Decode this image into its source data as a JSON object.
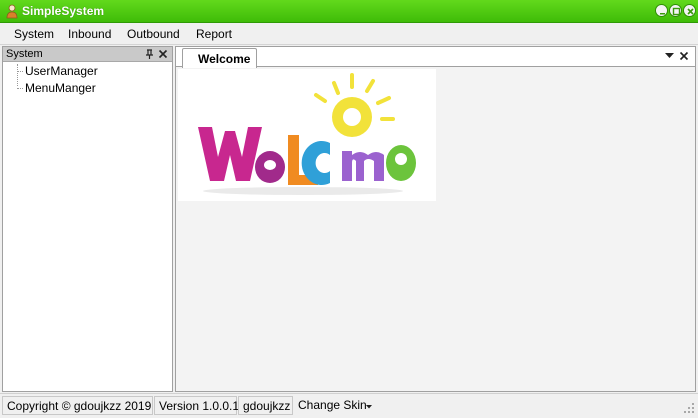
{
  "window": {
    "title": "SimpleSystem"
  },
  "menu": {
    "items": [
      "System",
      "Inbound",
      "Outbound",
      "Report"
    ]
  },
  "sidebar": {
    "title": "System",
    "items": [
      {
        "label": "UserManager"
      },
      {
        "label": "MenuManger"
      }
    ]
  },
  "tabs": [
    {
      "label": "Welcome"
    }
  ],
  "welcome": {
    "image_text": "WeLCOme"
  },
  "statusbar": {
    "copyright": "Copyright © gdoujkzz 2019",
    "version": "Version 1.0.0.1",
    "user": "gdoujkzz",
    "skin_label": "Change Skin"
  },
  "colors": {
    "titlebar": "#4ccb0e",
    "panel_header": "#c9c9c9"
  }
}
